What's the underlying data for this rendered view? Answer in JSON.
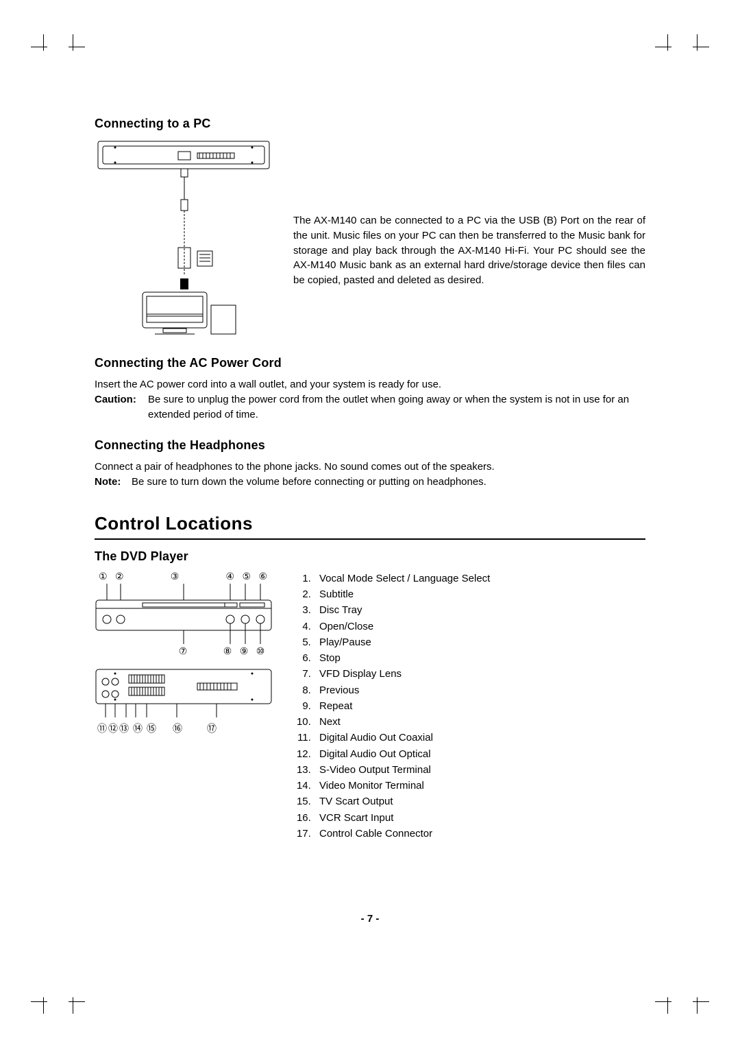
{
  "sections": {
    "pc": {
      "heading": "Connecting to a PC",
      "body": "The AX-M140 can be connected to a PC via the USB (B) Port on the rear of the unit. Music files on your PC can then be transferred to the Music bank for storage and play back through the AX-M140 Hi-Fi. Your PC should see the AX-M140 Music bank as an external hard drive/storage device then files can be copied, pasted and deleted as desired."
    },
    "ac": {
      "heading": "Connecting the AC Power Cord",
      "line1": "Insert the AC power cord into a wall outlet, and your system is ready for use.",
      "caution_label": "Caution:",
      "caution_body": "Be sure to unplug the power cord from the outlet when going away or when the system is not in use for an extended period of time."
    },
    "hp": {
      "heading": "Connecting the Headphones",
      "line1": "Connect a pair of headphones to the phone jacks. No sound comes out of the speakers.",
      "note_label": "Note:",
      "note_body": "Be sure to turn down the volume before connecting or putting on headphones."
    },
    "controls": {
      "heading": "Control Locations",
      "sub": "The DVD Player",
      "items": [
        "Vocal Mode Select / Language Select",
        "Subtitle",
        "Disc Tray",
        "Open/Close",
        "Play/Pause",
        "Stop",
        "VFD Display Lens",
        "Previous",
        "Repeat",
        "Next",
        "Digital Audio Out Coaxial",
        "Digital Audio Out Optical",
        "S-Video Output Terminal",
        "Video Monitor Terminal",
        "TV Scart Output",
        "VCR Scart Input",
        "Control Cable Connector"
      ]
    }
  },
  "callout_labels": {
    "top_front": [
      "①",
      "②",
      "③",
      "④",
      "⑤",
      "⑥"
    ],
    "mid_front": [
      "⑦",
      "⑧",
      "⑨",
      "⑩"
    ],
    "back_row": [
      "⑪",
      "⑫",
      "⑬",
      "⑭",
      "⑮",
      "⑯",
      "⑰"
    ]
  },
  "page_number": "- 7 -"
}
